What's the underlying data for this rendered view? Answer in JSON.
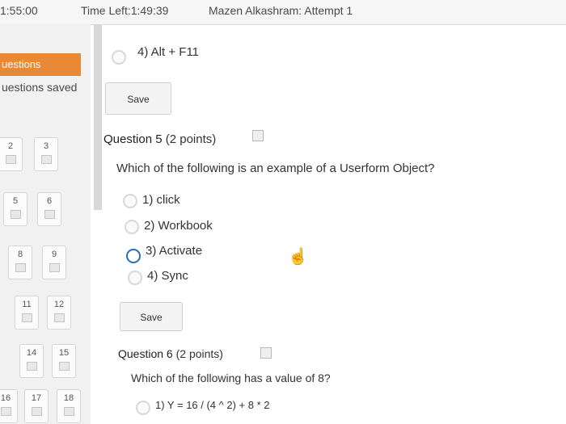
{
  "header": {
    "elapsed": "1:55:00",
    "time_left": "Time Left:1:49:39",
    "user_attempt": "Mazen Alkashram: Attempt 1"
  },
  "sidebar": {
    "title": "uestions",
    "saved": "uestions saved",
    "questions": [
      {
        "num": "2"
      },
      {
        "num": "3"
      },
      {
        "num": "5"
      },
      {
        "num": "6"
      },
      {
        "num": "8"
      },
      {
        "num": "9"
      },
      {
        "num": "11"
      },
      {
        "num": "12"
      },
      {
        "num": "14"
      },
      {
        "num": "15"
      },
      {
        "num": "16"
      },
      {
        "num": "17"
      },
      {
        "num": "18"
      }
    ]
  },
  "prev_question": {
    "option": "4) Alt + F11",
    "save_label": "Save"
  },
  "question5": {
    "title": "Question 5",
    "points": "(2 points)",
    "text": "Which of the following is an example of a Userform Object?",
    "options": [
      "1) click",
      "2) Workbook",
      "3) Activate",
      "4) Sync"
    ],
    "selected_index": 2,
    "save_label": "Save"
  },
  "question6": {
    "title": "Question 6",
    "points": "(2 points)",
    "text": "Which of the following has a value of 8?",
    "options": [
      "1) Y = 16 / (4 ^ 2) + 8 * 2"
    ]
  }
}
